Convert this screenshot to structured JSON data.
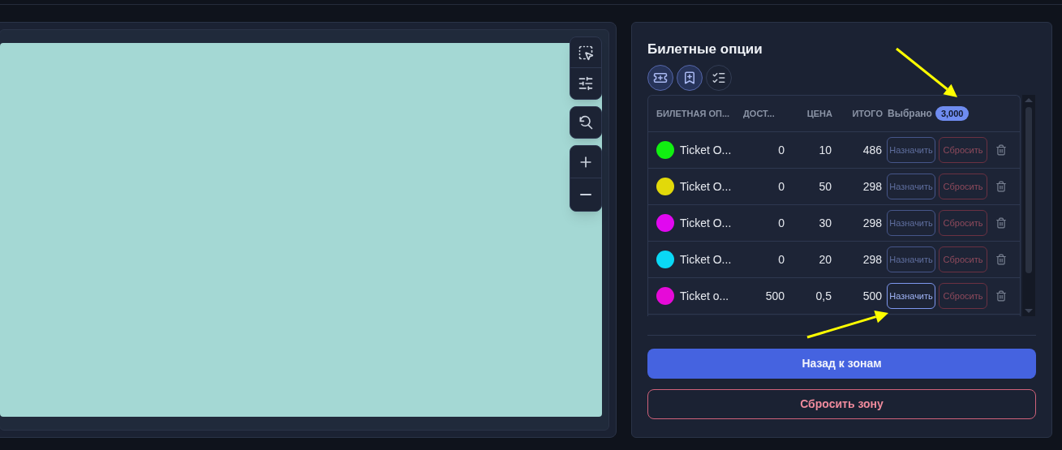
{
  "panel": {
    "title": "Билетные опции"
  },
  "toolbar": [
    {
      "kind": "ticket",
      "selected": true
    },
    {
      "kind": "bookmark",
      "selected": true
    },
    {
      "kind": "checklist",
      "selected": false
    }
  ],
  "table": {
    "columns": [
      "БИЛЕТНАЯ ОП...",
      "ДОСТ...",
      "ЦЕНА",
      "ИТОГО"
    ],
    "selected_label": "Выбрано",
    "selected_badge": "3,000",
    "rows": [
      {
        "color": "#11f011",
        "name": "Ticket O...",
        "available": "0",
        "price": "10",
        "total": "486",
        "assign": "Назначить",
        "reset": "Сбросить",
        "assign_active": false
      },
      {
        "color": "#e2d90a",
        "name": "Ticket O...",
        "available": "0",
        "price": "50",
        "total": "298",
        "assign": "Назначить",
        "reset": "Сбросить",
        "assign_active": false
      },
      {
        "color": "#e108f0",
        "name": "Ticket O...",
        "available": "0",
        "price": "30",
        "total": "298",
        "assign": "Назначить",
        "reset": "Сбросить",
        "assign_active": false
      },
      {
        "color": "#0ad8f5",
        "name": "Ticket O...",
        "available": "0",
        "price": "20",
        "total": "298",
        "assign": "Назначить",
        "reset": "Сбросить",
        "assign_active": false
      },
      {
        "color": "#e60ad8",
        "name": "Ticket o...",
        "available": "500",
        "price": "0,5",
        "total": "500",
        "assign": "Назначить",
        "reset": "Сбросить",
        "assign_active": true
      }
    ]
  },
  "buttons": {
    "back": "Назад к зонам",
    "reset_zone": "Сбросить зону"
  }
}
